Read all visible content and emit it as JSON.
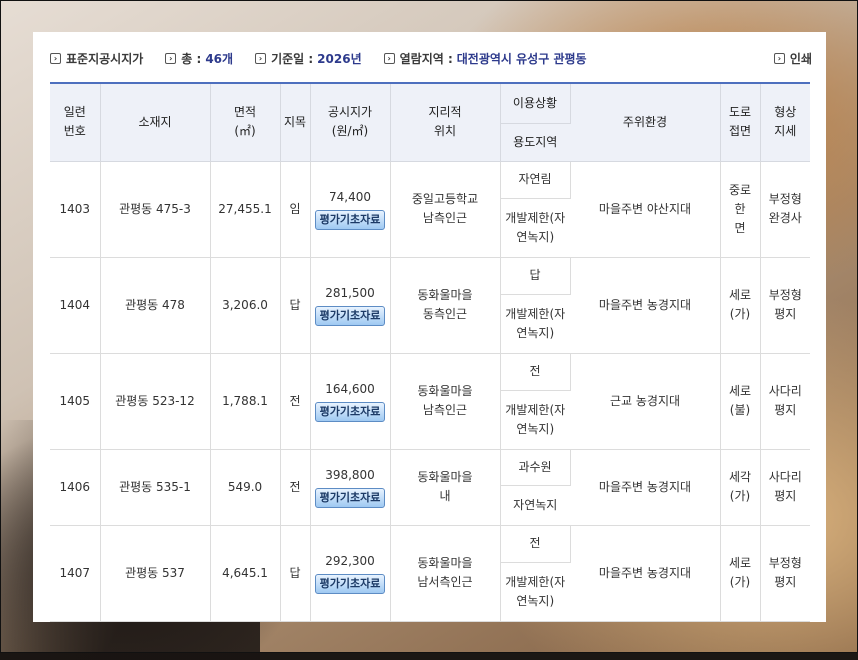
{
  "summary": {
    "title": "표준지공시지가",
    "total_label": "총 :",
    "total_value": "46개",
    "date_label": "기준일 :",
    "date_value": "2026년",
    "region_label": "열람지역 :",
    "region_value": "대전광역시 유성구 관평동",
    "print_label": "인쇄"
  },
  "headers": {
    "serial": "일련\n번호",
    "address": "소재지",
    "area": "면적\n(㎡)",
    "land_category": "지목",
    "price": "공시지가\n(원/㎡)",
    "location": "지리적\n위치",
    "usage_status": "이용상황",
    "zoning": "용도지역",
    "surroundings": "주위환경",
    "road": "도로\n접면",
    "shape": "형상\n지세"
  },
  "rows": [
    {
      "serial": "1403",
      "address": "관평동 475-3",
      "area": "27,455.1",
      "land_category": "임",
      "price": "74,400",
      "button": "평가기초자료",
      "location": "중일고등학교\n남측인근",
      "usage_status": "자연림",
      "zoning": "개발제한(자\n연녹지)",
      "surroundings": "마을주변 야산지대",
      "road": "중로한\n면",
      "shape": "부정형\n완경사"
    },
    {
      "serial": "1404",
      "address": "관평동 478",
      "area": "3,206.0",
      "land_category": "답",
      "price": "281,500",
      "button": "평가기초자료",
      "location": "동화울마을\n동측인근",
      "usage_status": "답",
      "zoning": "개발제한(자\n연녹지)",
      "surroundings": "마을주변 농경지대",
      "road": "세로\n(가)",
      "shape": "부정형\n평지"
    },
    {
      "serial": "1405",
      "address": "관평동 523-12",
      "area": "1,788.1",
      "land_category": "전",
      "price": "164,600",
      "button": "평가기초자료",
      "location": "동화울마을\n남측인근",
      "usage_status": "전",
      "zoning": "개발제한(자\n연녹지)",
      "surroundings": "근교 농경지대",
      "road": "세로\n(불)",
      "shape": "사다리\n평지"
    },
    {
      "serial": "1406",
      "address": "관평동 535-1",
      "area": "549.0",
      "land_category": "전",
      "price": "398,800",
      "button": "평가기초자료",
      "location": "동화울마을\n내",
      "usage_status": "과수원",
      "zoning": "자연녹지",
      "surroundings": "마을주변 농경지대",
      "road": "세각\n(가)",
      "shape": "사다리\n평지"
    },
    {
      "serial": "1407",
      "address": "관평동 537",
      "area": "4,645.1",
      "land_category": "답",
      "price": "292,300",
      "button": "평가기초자료",
      "location": "동화울마을\n남서측인근",
      "usage_status": "전",
      "zoning": "개발제한(자\n연녹지)",
      "surroundings": "마을주변 농경지대",
      "road": "세로\n(가)",
      "shape": "부정형\n평지"
    }
  ]
}
